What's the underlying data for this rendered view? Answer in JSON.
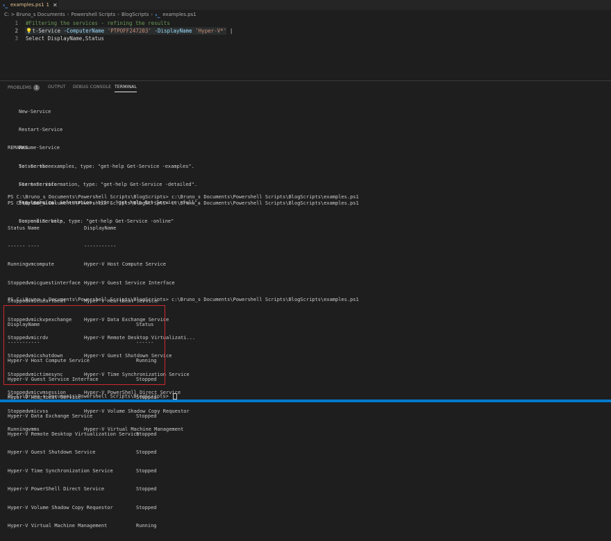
{
  "tab": {
    "filename": "examples.ps1",
    "badge": "1",
    "close": "✕"
  },
  "breadcrumb": {
    "items": [
      "C: > Bruno_s Documents",
      "Powershell Scripts",
      "BlogScripts"
    ],
    "file": "examples.ps1"
  },
  "editor": {
    "lines": [
      {
        "num": "1",
        "text": "#Filtering the services - refining the results"
      },
      {
        "num": "2",
        "cmd": "t-Service",
        "p1": "-ComputerName",
        "s1": "'PTPOFF247203'",
        "p2": "-DisplayName",
        "s2": "'Hyper-V*'",
        "pipe": "|"
      },
      {
        "num": "3",
        "text": "Select DisplayName,Status"
      }
    ]
  },
  "panel": {
    "tabs": [
      {
        "label": "PROBLEMS",
        "badge": "1"
      },
      {
        "label": "OUTPUT"
      },
      {
        "label": "DEBUG CONSOLE"
      },
      {
        "label": "TERMINAL"
      }
    ]
  },
  "terminal": {
    "related": [
      "New-Service",
      "Restart-Service",
      "Resume-Service",
      "Set-Service",
      "Start-Service",
      "Stop-Service",
      "Suspend-Service"
    ],
    "remarks_header": "REMARKS",
    "remarks": [
      "To see the examples, type: \"get-help Get-Service -examples\".",
      "For more information, type: \"get-help Get-Service -detailed\".",
      "For technical information, type: \"get-help Get-Service -full\".",
      "For online help, type: \"get-help Get-Service -online\""
    ],
    "prompt_run": "PS C:\\Bruno_s Documents\\Powershell Scripts\\BlogScripts> c:\\Bruno_s Documents\\Powershell Scripts\\BlogScripts\\examples.ps1",
    "prompt_path": "PS C:\\Bruno_s Documents\\Powershell Scripts\\BlogScripts>",
    "table1": {
      "headers": [
        "Status",
        "Name",
        "DisplayName"
      ],
      "dividers": [
        "------",
        "----",
        "-----------"
      ],
      "rows": [
        [
          "Running",
          "vmcompute",
          "Hyper-V Host Compute Service"
        ],
        [
          "Stopped",
          "vmicguestinterface",
          "Hyper-V Guest Service Interface"
        ],
        [
          "Stopped",
          "vmicheartbeat",
          "Hyper-V Heartbeat Service"
        ],
        [
          "Stopped",
          "vmickvpexchange",
          "Hyper-V Data Exchange Service"
        ],
        [
          "Stopped",
          "vmicrdv",
          "Hyper-V Remote Desktop Virtualizati..."
        ],
        [
          "Stopped",
          "vmicshutdown",
          "Hyper-V Guest Shutdown Service"
        ],
        [
          "Stopped",
          "vmictimesync",
          "Hyper-V Time Synchronization Service"
        ],
        [
          "Stopped",
          "vmicvmsession",
          "Hyper-V PowerShell Direct Service"
        ],
        [
          "Stopped",
          "vmicvss",
          "Hyper-V Volume Shadow Copy Requestor"
        ],
        [
          "Running",
          "vmms",
          "Hyper-V Virtual Machine Management"
        ]
      ]
    },
    "table2": {
      "headers": [
        "DisplayName",
        "Status"
      ],
      "dividers": [
        "-----------",
        "------"
      ],
      "rows": [
        [
          "Hyper-V Host Compute Service",
          "Running"
        ],
        [
          "Hyper-V Guest Service Interface",
          "Stopped"
        ],
        [
          "Hyper-V Heartbeat Service",
          "Stopped"
        ],
        [
          "Hyper-V Data Exchange Service",
          "Stopped"
        ],
        [
          "Hyper-V Remote Desktop Virtualization Service",
          "Stopped"
        ],
        [
          "Hyper-V Guest Shutdown Service",
          "Stopped"
        ],
        [
          "Hyper-V Time Synchronization Service",
          "Stopped"
        ],
        [
          "Hyper-V PowerShell Direct Service",
          "Stopped"
        ],
        [
          "Hyper-V Volume Shadow Copy Requestor",
          "Stopped"
        ],
        [
          "Hyper-V Virtual Machine Management",
          "Running"
        ]
      ]
    }
  },
  "colors": {
    "highlight_box": "#d0282e",
    "statusbar": "#007acc"
  }
}
